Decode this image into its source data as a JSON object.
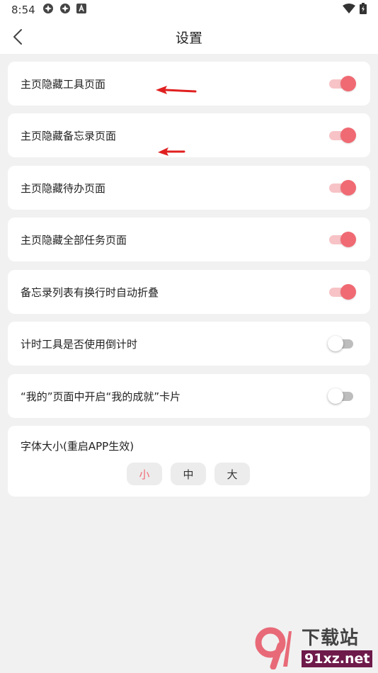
{
  "status_bar": {
    "time": "8:54",
    "left_icons": [
      "app-icon",
      "app-icon",
      "font-icon"
    ],
    "right_icons": [
      "wifi-icon",
      "battery-icon"
    ]
  },
  "header": {
    "title": "设置",
    "back_icon": "back-arrow-icon"
  },
  "settings": [
    {
      "label": "主页隐藏工具页面",
      "enabled": true
    },
    {
      "label": "主页隐藏备忘录页面",
      "enabled": true
    },
    {
      "label": "主页隐藏待办页面",
      "enabled": true
    },
    {
      "label": "主页隐藏全部任务页面",
      "enabled": true
    },
    {
      "label": "备忘录列表有换行时自动折叠",
      "enabled": true
    },
    {
      "label": "计时工具是否使用倒计时",
      "enabled": false
    },
    {
      "label": "“我的”页面中开启“我的成就”卡片",
      "enabled": false
    }
  ],
  "font_size": {
    "label": "字体大小(重启APP生效)",
    "options": [
      "小",
      "中",
      "大"
    ],
    "selected": "小"
  },
  "watermark": {
    "title": "下载站",
    "site": "91xz.net"
  },
  "colors": {
    "accent": "#f06a73",
    "track_on": "#f7c3c6",
    "annotation_arrow": "#e02020",
    "background": "#f1f1f1"
  }
}
